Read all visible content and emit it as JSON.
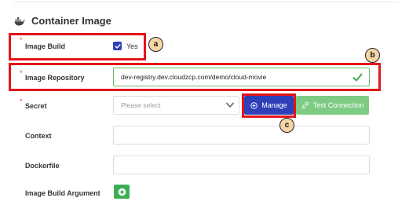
{
  "section": {
    "title": "Container Image",
    "icon": "docker-whale-icon"
  },
  "fields": {
    "image_build": {
      "label": "Image Build",
      "checked": true,
      "checkbox_label": "Yes"
    },
    "image_repository": {
      "label": "Image Repository",
      "value": "dev-registry.dev.cloudzcp.com/demo/cloud-movie",
      "valid": true
    },
    "secret": {
      "label": "Secret",
      "placeholder": "Please select"
    },
    "context": {
      "label": "Context",
      "value": ""
    },
    "dockerfile": {
      "label": "Dockerfile",
      "value": ""
    },
    "image_build_argument": {
      "label": "Image Build Argument"
    }
  },
  "buttons": {
    "manage": "Manage",
    "test_connection": "Test Connection"
  },
  "annotations": {
    "a": "a",
    "b": "b",
    "c": "c"
  },
  "colors": {
    "primary": "#2f3fb7",
    "success": "#3dae53",
    "success_light": "#7ecb84",
    "highlight": "#e3141b",
    "badge": "#f5d5a6"
  }
}
